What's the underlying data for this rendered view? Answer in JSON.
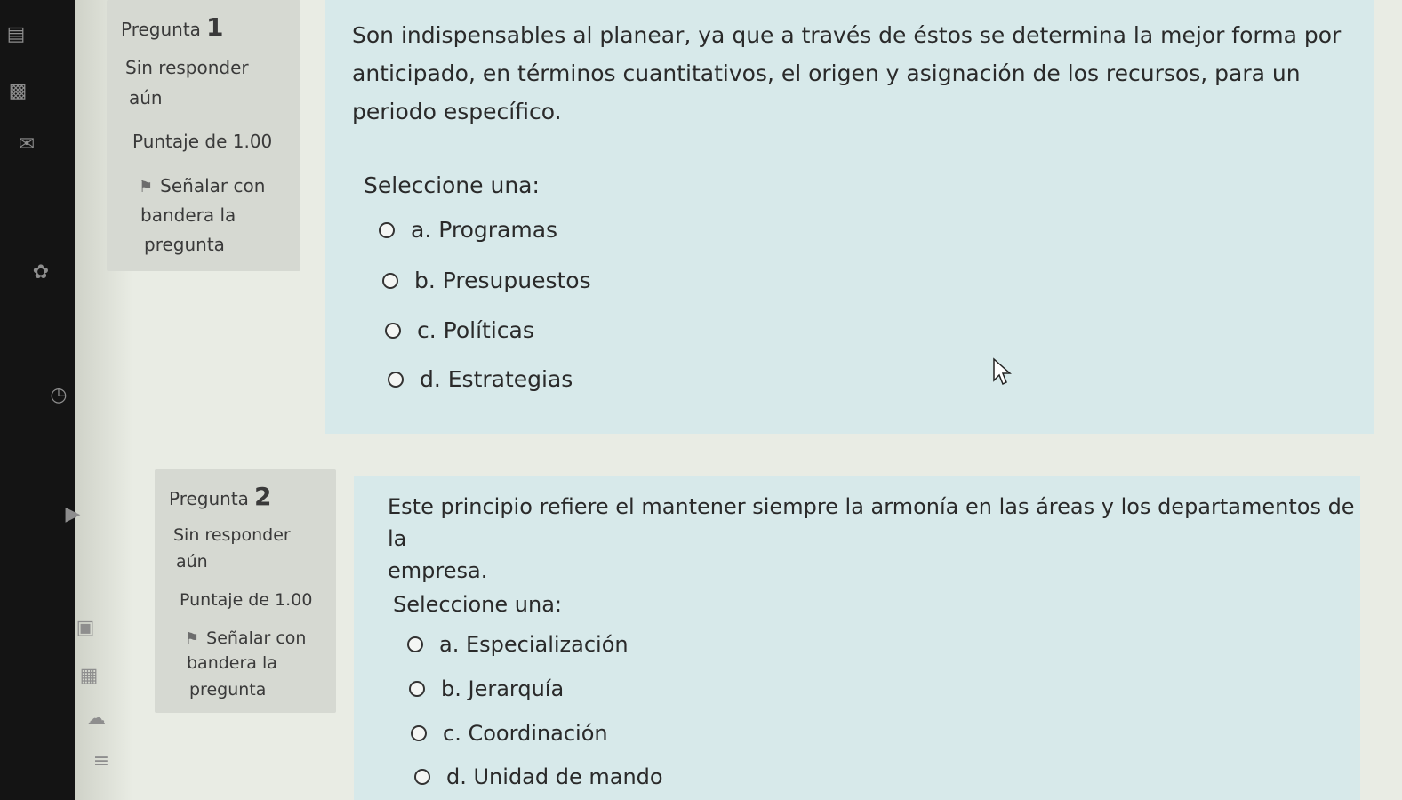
{
  "sidebar_icons": [
    "calendar-icon",
    "image-icon",
    "mail-icon",
    "openai-icon",
    "clock-icon",
    "play-icon",
    "bookmark-icon",
    "folder-icon",
    "cloud-icon",
    "text-icon"
  ],
  "questions": [
    {
      "label": "Pregunta",
      "number": "1",
      "status_line1": "Sin responder",
      "status_line2": "aún",
      "score": "Puntaje de 1.00",
      "flag_line1": "Señalar con",
      "flag_line2": "bandera la",
      "flag_line3": "pregunta",
      "text_lines": [
        "Son indispensables al planear, ya que a través de éstos se determina la mejor forma por",
        "anticipado, en términos cuantitativos, el origen y asignación de los recursos, para un",
        "periodo específico."
      ],
      "prompt": "Seleccione una:",
      "options": [
        "a. Programas",
        "b. Presupuestos",
        "c. Políticas",
        "d. Estrategias"
      ]
    },
    {
      "label": "Pregunta",
      "number": "2",
      "status_line1": "Sin responder",
      "status_line2": "aún",
      "score": "Puntaje de 1.00",
      "flag_line1": "Señalar con",
      "flag_line2": "bandera la",
      "flag_line3": "pregunta",
      "text_lines": [
        "Este principio refiere el mantener siempre la armonía en las áreas y los departamentos de la",
        "empresa."
      ],
      "prompt": "Seleccione una:",
      "options": [
        "a. Especialización",
        "b. Jerarquía",
        "c. Coordinación",
        "d. Unidad de mando"
      ]
    }
  ]
}
